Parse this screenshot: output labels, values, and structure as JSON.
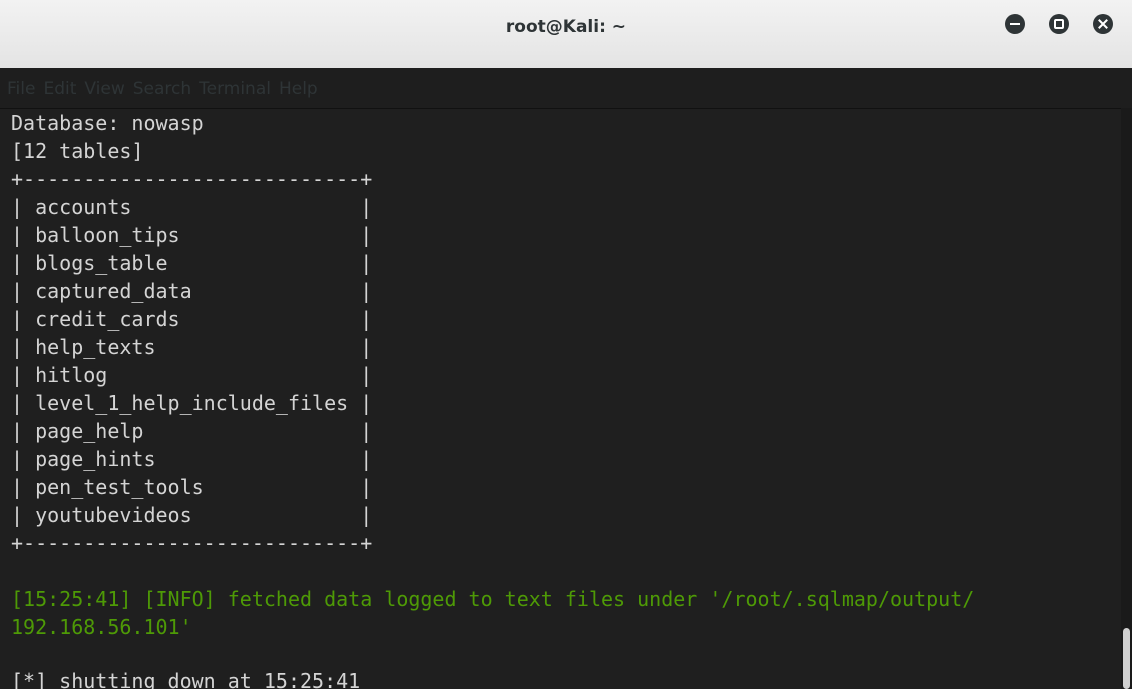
{
  "window": {
    "title": "root@Kali: ~"
  },
  "menu": {
    "items": [
      "File",
      "Edit",
      "View",
      "Search",
      "Terminal",
      "Help"
    ]
  },
  "colors": {
    "terminal_bg": "#1f1f1f",
    "text": "#d4d4d4",
    "info_green": "#4e9a06",
    "titlebar": "#e9e9e9"
  },
  "terminal": {
    "lines": [
      "Database: nowasp",
      "[12 tables]",
      "+----------------------------+",
      "| accounts                   |",
      "| balloon_tips               |",
      "| blogs_table                |",
      "| captured_data              |",
      "| credit_cards               |",
      "| help_texts                 |",
      "| hitlog                     |",
      "| level_1_help_include_files |",
      "| page_help                  |",
      "| page_hints                 |",
      "| pen_test_tools             |",
      "| youtubevideos              |",
      "+----------------------------+",
      "",
      "[15:25:41] [INFO] fetched data logged to text files under '/root/.sqlmap/output/",
      "192.168.56.101'",
      "",
      "[*] shutting down at 15:25:41"
    ]
  }
}
